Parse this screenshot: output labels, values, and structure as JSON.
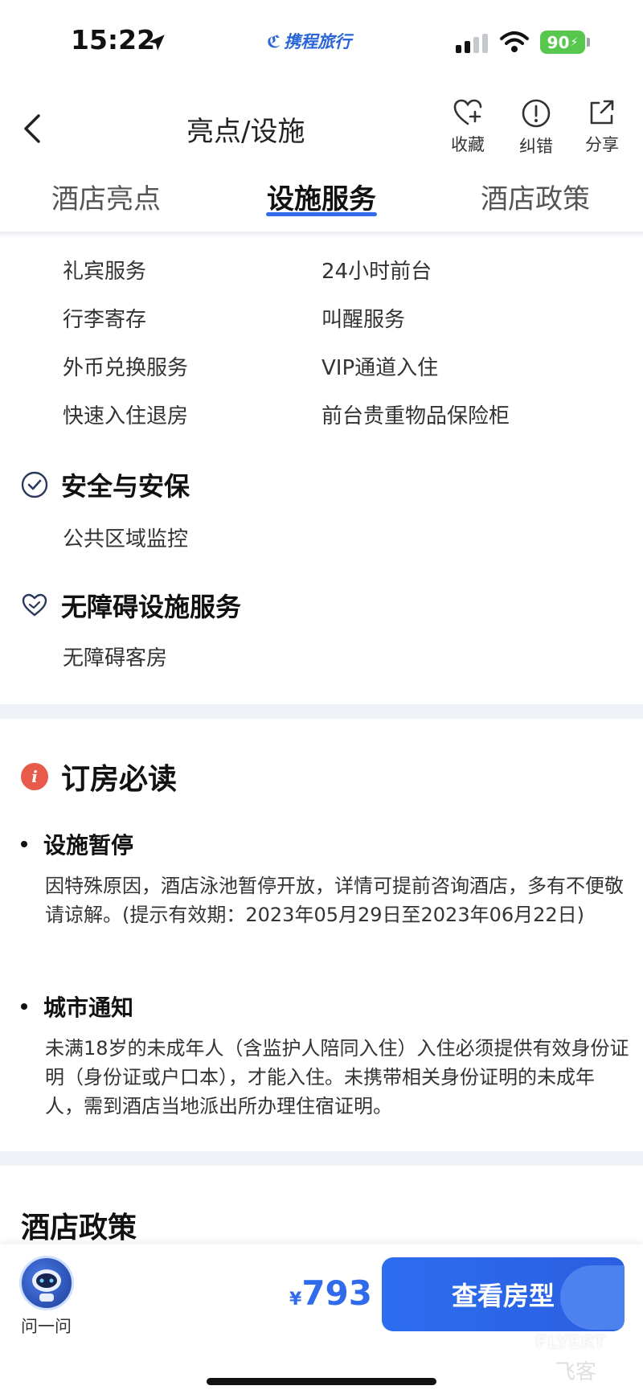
{
  "status_bar": {
    "time": "15:22",
    "brand": "携程旅行",
    "battery": "90"
  },
  "header": {
    "title": "亮点/设施",
    "actions": [
      {
        "label": "收藏",
        "icon": "heart-plus-icon"
      },
      {
        "label": "纠错",
        "icon": "exclamation-circle-icon"
      },
      {
        "label": "分享",
        "icon": "share-icon"
      }
    ]
  },
  "tabs": [
    {
      "label": "酒店亮点",
      "active": false
    },
    {
      "label": "设施服务",
      "active": true
    },
    {
      "label": "酒店政策",
      "active": false
    }
  ],
  "facilities": {
    "services": [
      "礼宾服务",
      "24小时前台",
      "行李寄存",
      "叫醒服务",
      "外币兑换服务",
      "VIP通道入住",
      "快速入住退房",
      "前台贵重物品保险柜"
    ],
    "security": {
      "title": "安全与安保",
      "icon": "check-circle-icon",
      "items": [
        "公共区域监控"
      ]
    },
    "accessibility": {
      "title": "无障碍设施服务",
      "icon": "heart-hand-icon",
      "items": [
        "无障碍客房"
      ]
    }
  },
  "must_read": {
    "title": "订房必读",
    "notices": [
      {
        "title": "设施暂停",
        "body": "因特殊原因，酒店泳池暂停开放，详情可提前咨询酒店，多有不便敬请谅解。(提示有效期：2023年05月29日至2023年06月22日)"
      },
      {
        "title": "城市通知",
        "body": "未满18岁的未成年人（含监护人陪同入住）入住必须提供有效身份证明（身份证或户口本），才能入住。未携带相关身份证明的未成年人，需到酒店当地派出所办理住宿证明。"
      }
    ]
  },
  "policy_section_title": "酒店政策",
  "bottom_bar": {
    "ask_label": "问一问",
    "currency": "¥",
    "price": "793",
    "book_button": "查看房型",
    "watermark": "FLYERT",
    "watermark_sub": "飞客"
  },
  "colors": {
    "accent": "#2f6bea",
    "alert": "#e85b4a",
    "divider": "#eef1f5"
  }
}
